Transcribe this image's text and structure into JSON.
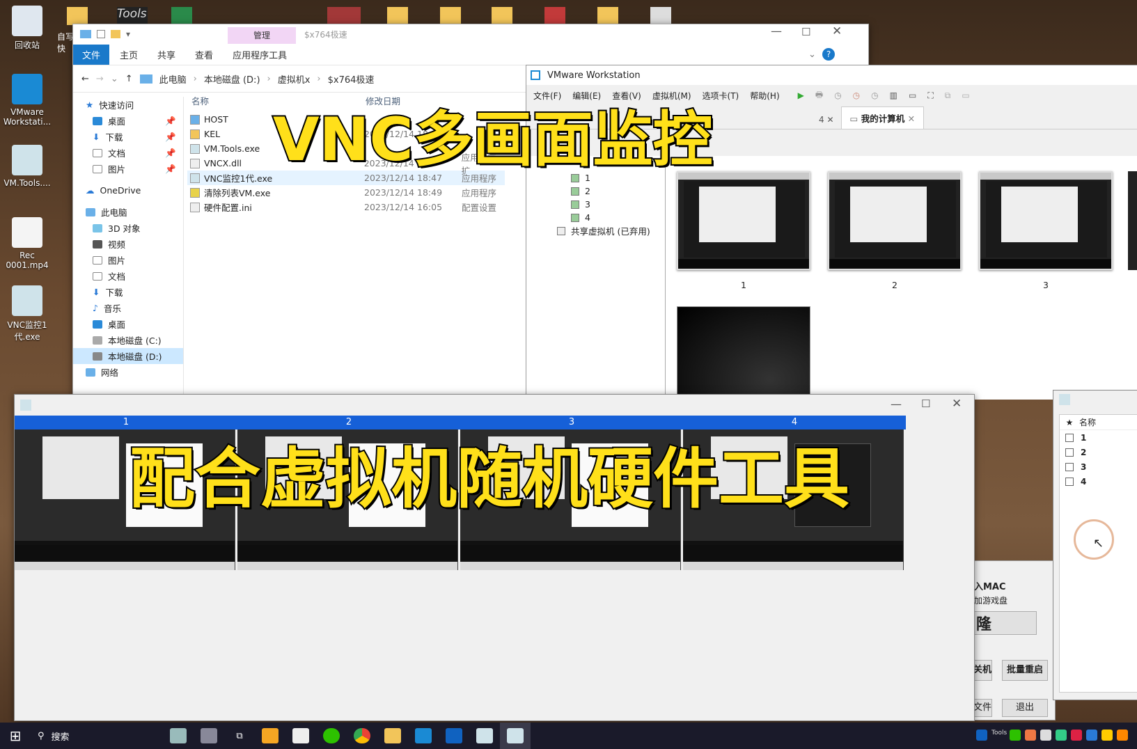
{
  "desktop": {
    "icons": [
      {
        "label": "回收站",
        "icon": "recycle-bin-icon"
      },
      {
        "label": "VMware Workstati...",
        "icon": "vmware-icon"
      },
      {
        "label": "VM.Tools....",
        "icon": "app-icon"
      },
      {
        "label": "Rec 0001.mp4",
        "icon": "video-file-icon"
      },
      {
        "label": "VNC监控1代.exe",
        "icon": "app-icon"
      }
    ],
    "partial_label": "自写 快"
  },
  "explorer": {
    "title": "$x764极速",
    "manage_tab": "管理",
    "tabs": [
      "文件",
      "主页",
      "共享",
      "查看",
      "应用程序工具"
    ],
    "breadcrumb": [
      "此电脑",
      "本地磁盘 (D:)",
      "虚拟机x",
      "$x764极速"
    ],
    "nav": [
      "快速访问",
      "桌面",
      "下载",
      "文档",
      "图片",
      "OneDrive",
      "此电脑",
      "3D 对象",
      "视频",
      "图片",
      "文档",
      "下载",
      "音乐",
      "桌面",
      "本地磁盘 (C:)",
      "本地磁盘 (D:)",
      "网络"
    ],
    "columns": [
      "名称",
      "修改日期"
    ],
    "files": [
      {
        "name": "HOST",
        "date": "",
        "type": ""
      },
      {
        "name": "KEL",
        "date": "2023/12/14 18",
        "type": ""
      },
      {
        "name": "VM.Tools.exe",
        "date": "",
        "type": ""
      },
      {
        "name": "VNCX.dll",
        "date": "2023/12/14",
        "type": "应用程序扩"
      },
      {
        "name": "VNC监控1代.exe",
        "date": "2023/12/14 18:47",
        "type": "应用程序"
      },
      {
        "name": "清除列表VM.exe",
        "date": "2023/12/14 18:49",
        "type": "应用程序"
      },
      {
        "name": "硬件配置.ini",
        "date": "2023/12/14 16:05",
        "type": "配置设置"
      }
    ]
  },
  "vmware": {
    "title": "VMware Workstation",
    "menu": [
      "文件(F)",
      "编辑(E)",
      "查看(V)",
      "虚拟机(M)",
      "选项卡(T)",
      "帮助(H)"
    ],
    "tab_prev": "4",
    "tab": "我的计算机",
    "tree": [
      "1",
      "2",
      "3",
      "4",
      "共享虚拟机 (已弃用)"
    ],
    "thumb_labels": [
      "1",
      "2",
      "3"
    ]
  },
  "vnc": {
    "headers": [
      "1",
      "2",
      "3",
      "4"
    ]
  },
  "dialog": {
    "col_star": "★",
    "col_name": "名称",
    "rows": [
      "1",
      "2",
      "3",
      "4"
    ],
    "partial_text1": "入MAC",
    "partial_text2": "加游戏盘",
    "partial_text3": "隆",
    "btn_shutdown": "关机",
    "btn_reboot": "批量重启",
    "btn_file": "文件",
    "btn_exit": "退出"
  },
  "overlay": {
    "title1": "VNC多画面监控",
    "title2": "配合虚拟机随机硬件工具"
  },
  "taskbar": {
    "search": "搜索",
    "tools_label": "Tools"
  },
  "colors": {
    "accent": "#1979ca",
    "vnc_header": "#1660d8",
    "title_yellow": "#ffe01a"
  }
}
